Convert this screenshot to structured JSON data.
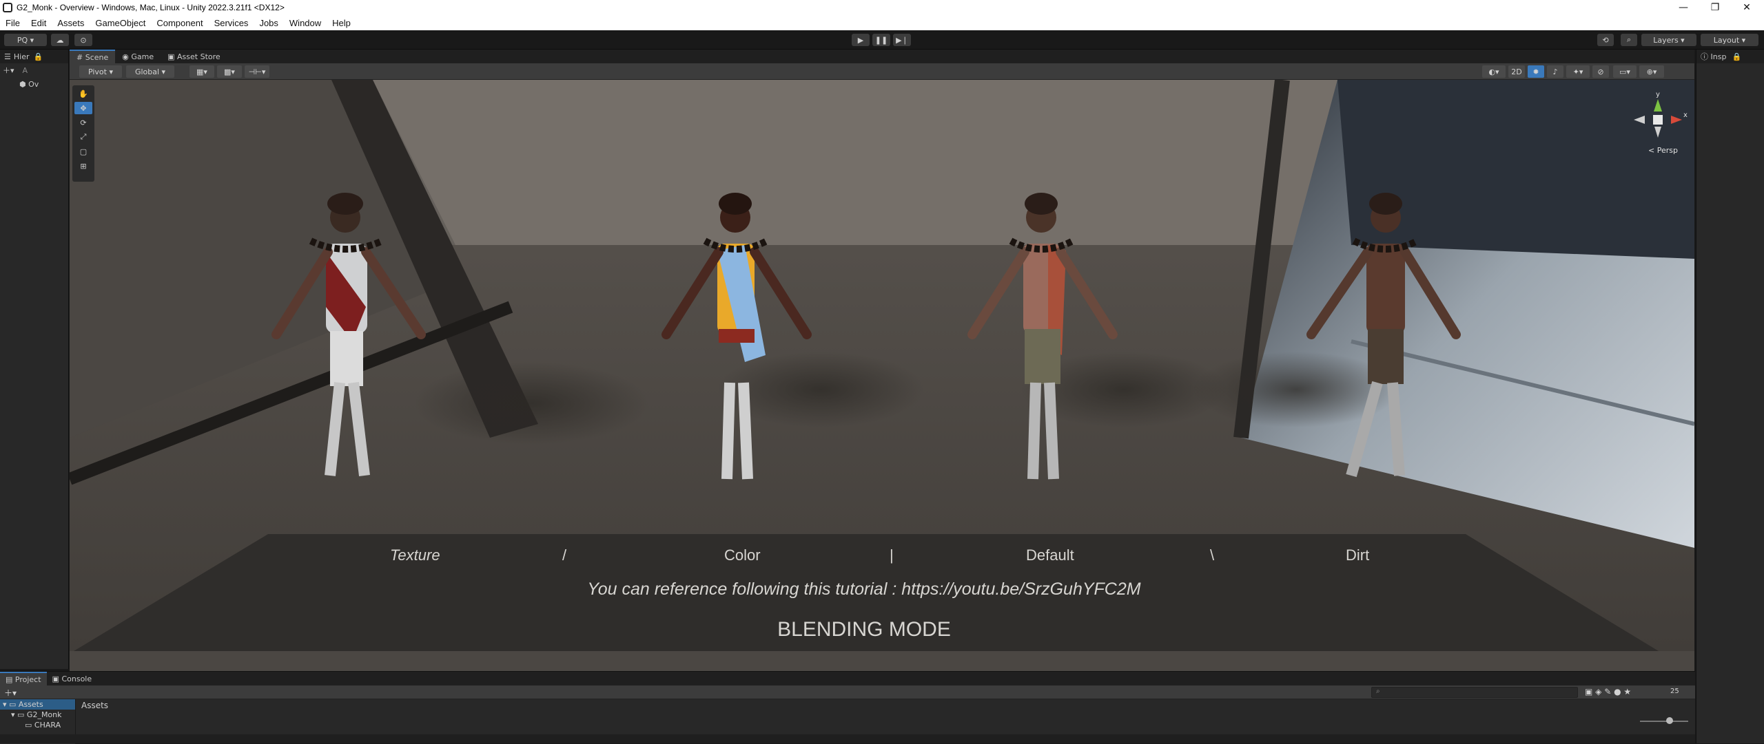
{
  "window": {
    "title": "G2_Monk - Overview - Windows, Mac, Linux - Unity 2022.3.21f1 <DX12>",
    "minimize": "—",
    "maximize": "❐",
    "close": "✕"
  },
  "menu": [
    "File",
    "Edit",
    "Assets",
    "GameObject",
    "Component",
    "Services",
    "Jobs",
    "Window",
    "Help"
  ],
  "toolbar": {
    "account": "PQ",
    "layers": "Layers",
    "layout": "Layout"
  },
  "hierarchy": {
    "tab": "Hier",
    "search": "A",
    "row": "Ov"
  },
  "scene": {
    "tabs": [
      "Scene",
      "Game",
      "Asset Store"
    ],
    "pivot": "Pivot",
    "global": "Global",
    "mode_2d": "2D",
    "persp": "< Persp",
    "gizmo_y": "y",
    "gizmo_x": "x"
  },
  "viewport": {
    "labels": [
      "Texture",
      "/",
      "Color",
      "|",
      "Default",
      "\\",
      "Dirt"
    ],
    "tutorial": "You can reference following this tutorial : https://youtu.be/SrzGuhYFC2M",
    "mode": "BLENDING MODE"
  },
  "inspector": {
    "tab": "Insp"
  },
  "project": {
    "tabs": [
      "Project",
      "Console"
    ],
    "breadcrumb": "Assets",
    "tree": [
      "Assets",
      "G2_Monk",
      "CHARA"
    ],
    "hidden_count": "25"
  },
  "colors": {
    "accent": "#3a79bb",
    "panel": "#282828",
    "floor": "#4a4642"
  }
}
